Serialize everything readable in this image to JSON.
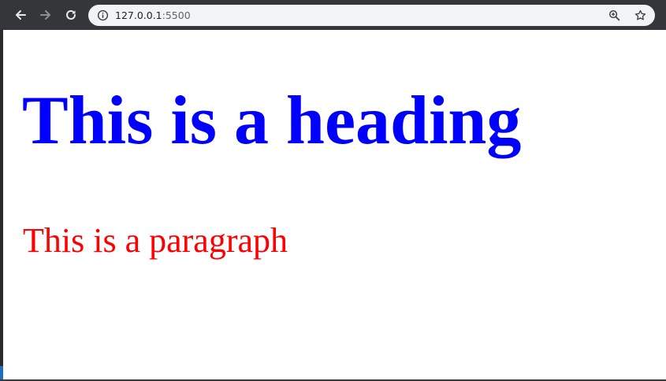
{
  "browser": {
    "back_icon": "arrow-left-icon",
    "forward_icon": "arrow-right-icon",
    "reload_icon": "reload-icon",
    "site_info_icon": "info-circle-icon",
    "zoom_icon": "zoom-in-icon",
    "bookmark_icon": "star-outline-icon",
    "url": {
      "host": "127.0.0.1",
      "port": ":5500"
    },
    "colors": {
      "toolbar": "#35363a",
      "omnibox": "#f1f3f4"
    }
  },
  "page": {
    "heading": "This is a heading",
    "paragraph": "This is a paragraph",
    "colors": {
      "heading": "#0000ff",
      "paragraph": "#ff0000",
      "background": "#ffffff"
    }
  }
}
